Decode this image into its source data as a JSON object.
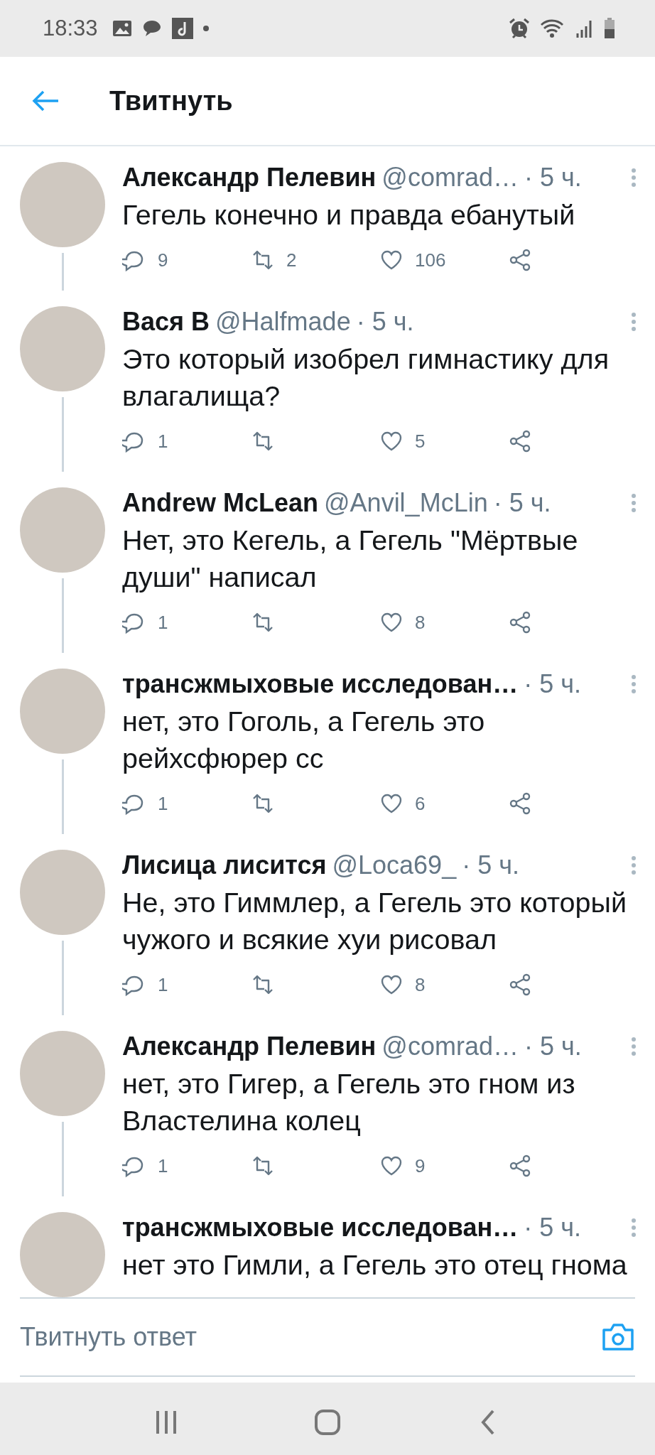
{
  "status_bar": {
    "time": "18:33"
  },
  "header": {
    "title": "Твитнуть"
  },
  "tweets": [
    {
      "name": "Александр Пелевин",
      "handle": "@comrad…",
      "time": "· 5 ч.",
      "text": "Гегель конечно и правда ебанутый",
      "actions": {
        "replies": "9",
        "retweets": "2",
        "likes": "106"
      }
    },
    {
      "name": "Вася В",
      "handle": "@Halfmade",
      "time": "· 5 ч.",
      "text": "Это который изобрел гимнастику для влагалища?",
      "actions": {
        "replies": "1",
        "likes": "5"
      }
    },
    {
      "name": "Andrew McLean",
      "handle": "@Anvil_McLin",
      "time": "· 5 ч.",
      "text": "Нет, это Кегель, а Гегель \"Мёртвые души\" написал",
      "actions": {
        "replies": "1",
        "likes": "8"
      }
    },
    {
      "name": "трансжмыховые исследован…",
      "time": "· 5 ч.",
      "text": "нет, это Гоголь, а Гегель это рейхсфюрер сс",
      "actions": {
        "replies": "1",
        "likes": "6"
      }
    },
    {
      "name": "Лисица лисится",
      "handle": "@Loca69_",
      "time": "· 5 ч.",
      "text": "Не, это Гиммлер, а Гегель это который чужого и всякие хуи рисовал",
      "actions": {
        "replies": "1",
        "likes": "8"
      }
    },
    {
      "name": "Александр Пелевин",
      "handle": "@comrad…",
      "time": "· 5 ч.",
      "text": "нет, это Гигер, а Гегель это гном из Властелина колец",
      "actions": {
        "replies": "1",
        "likes": "9"
      }
    },
    {
      "name": "трансжмыховые исследован…",
      "time": "· 5 ч.",
      "text": "нет это Гимли, а Гегель это отец гнома"
    }
  ],
  "compose": {
    "placeholder": "Твитнуть ответ"
  }
}
